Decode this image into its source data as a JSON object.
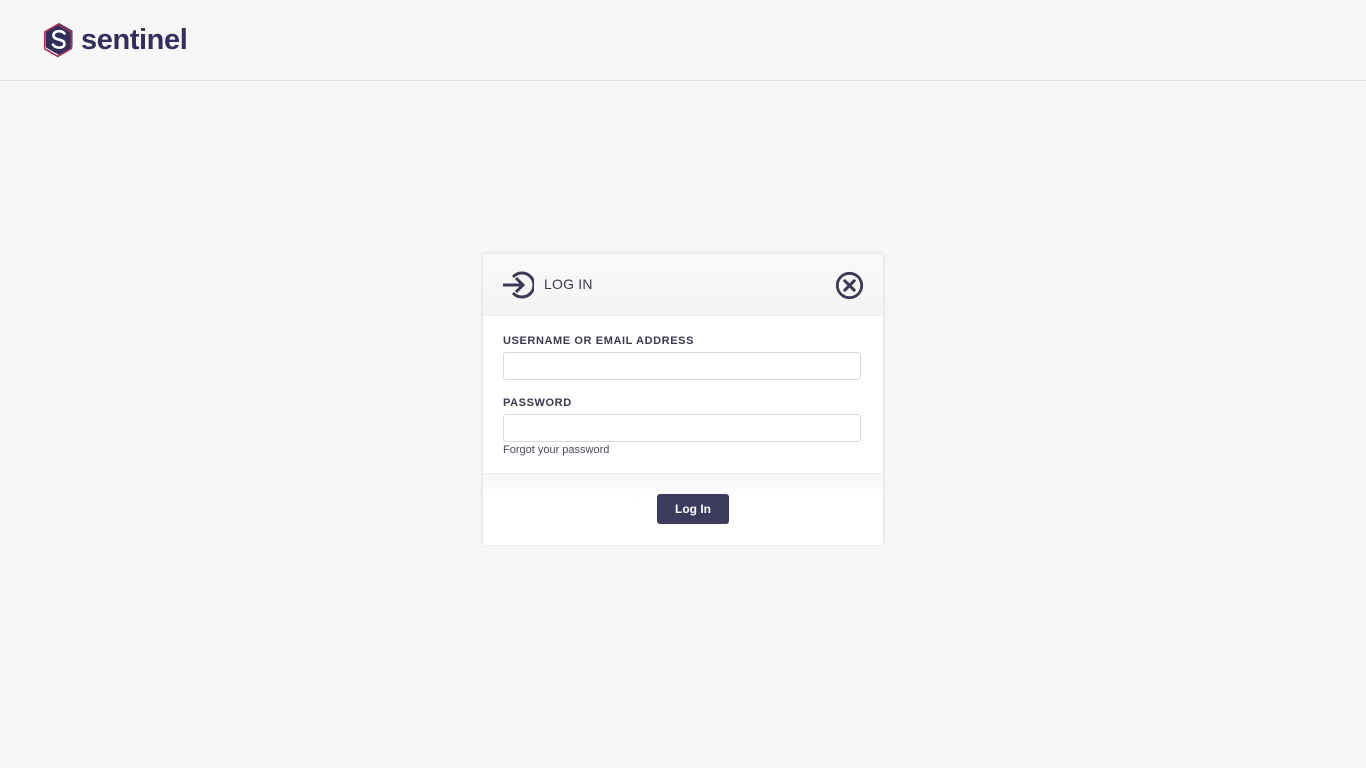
{
  "brand": {
    "name": "sentinel",
    "primary_color": "#32305a",
    "accent_color": "#a8305a",
    "logo_icon": "sentinel-s-hexagon-logo"
  },
  "login_dialog": {
    "title": "LOG IN",
    "header_icon": "login-arrow-icon",
    "close_icon": "close-circle-icon",
    "username_label": "USERNAME OR EMAIL ADDRESS",
    "username_value": "",
    "password_label": "PASSWORD",
    "password_value": "",
    "forgot_link": "Forgot your password",
    "submit_label": "Log In"
  }
}
